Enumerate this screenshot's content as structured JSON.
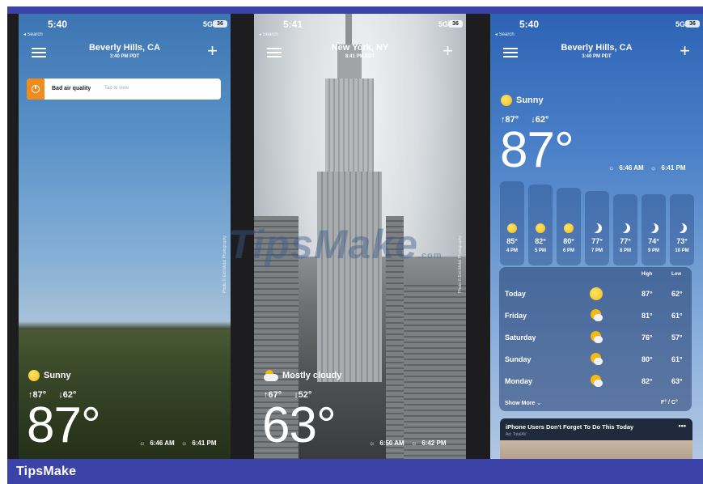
{
  "brand": {
    "label": "TipsMake"
  },
  "watermark": {
    "text": "TipsMake",
    "suffix": ".com"
  },
  "colors": {
    "accent": "#3b43a8",
    "alert": "#f08c1d",
    "sun": "#f4b912"
  },
  "phones": [
    {
      "status": {
        "time": "5:40",
        "back": "◂ Search",
        "network": "5G",
        "battery": "36"
      },
      "header": {
        "city": "Beverly Hills, CA",
        "time": "3:40 PM PDT"
      },
      "alert": {
        "title": "Bad air quality",
        "hint": "Tap to view"
      },
      "photo_credit": "Photo © Evil Metal Photography",
      "condition": "Sunny",
      "high": "↑87°",
      "low": "↓62°",
      "temp": "87°",
      "sunrise": "6:46 AM",
      "sunset": "6:41 PM"
    },
    {
      "status": {
        "time": "5:41",
        "back": "◂ Search",
        "network": "5G",
        "battery": "36"
      },
      "header": {
        "city": "New York, NY",
        "time": "8:41 PM EDT"
      },
      "photo_credit": "Photo © Evil Metal Photography",
      "condition": "Mostly cloudy",
      "high": "↑67°",
      "low": "↓52°",
      "temp": "63°",
      "sunrise": "6:50 AM",
      "sunset": "6:42 PM"
    },
    {
      "status": {
        "time": "5:40",
        "back": "◂ Search",
        "network": "5G",
        "battery": "36"
      },
      "header": {
        "city": "Beverly Hills, CA",
        "time": "3:40 PM PDT"
      },
      "condition": "Sunny",
      "high": "↑87°",
      "low": "↓62°",
      "temp": "87°",
      "sunrise": "6:46 AM",
      "sunset": "6:41 PM",
      "hourly": [
        {
          "temp": "85°",
          "label": "4 PM",
          "icon": "sun-icon"
        },
        {
          "temp": "82°",
          "label": "5 PM",
          "icon": "sun-icon"
        },
        {
          "temp": "80°",
          "label": "6 PM",
          "icon": "sun-icon"
        },
        {
          "temp": "77°",
          "label": "7 PM",
          "icon": "moon-icon"
        },
        {
          "temp": "77°",
          "label": "8 PM",
          "icon": "moon-icon"
        },
        {
          "temp": "74°",
          "label": "9 PM",
          "icon": "moon-icon"
        },
        {
          "temp": "73°",
          "label": "10 PM",
          "icon": "moon-icon"
        }
      ],
      "daily_header": {
        "high": "High",
        "low": "Low"
      },
      "daily": [
        {
          "day": "Today",
          "icon": "sun-icon",
          "high": "87°",
          "low": "62°"
        },
        {
          "day": "Friday",
          "icon": "partly-cloudy-icon",
          "high": "81°",
          "low": "61°"
        },
        {
          "day": "Saturday",
          "icon": "partly-cloudy-icon",
          "high": "76°",
          "low": "57°"
        },
        {
          "day": "Sunday",
          "icon": "partly-cloudy-icon",
          "high": "80°",
          "low": "61°"
        },
        {
          "day": "Monday",
          "icon": "partly-cloudy-icon",
          "high": "82°",
          "low": "63°"
        }
      ],
      "show_more": "Show More ⌄",
      "units": "F° / C°",
      "promo": {
        "title": "iPhone Users Don't Forget To Do This Today",
        "sponsor": "Ad: TotalAV",
        "menu": "•••"
      }
    }
  ]
}
